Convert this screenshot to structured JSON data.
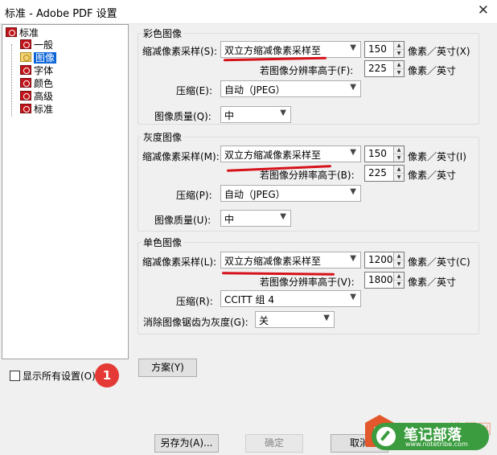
{
  "window": {
    "title": "标准 - Adobe PDF 设置",
    "close_glyph": "✕"
  },
  "tree": {
    "items": [
      {
        "label": "标准",
        "icon": "pdf-settings-icon",
        "selected": false
      },
      {
        "label": "一般",
        "icon": "pdf-settings-icon",
        "selected": false
      },
      {
        "label": "图像",
        "icon": "open-folder-icon",
        "selected": true
      },
      {
        "label": "字体",
        "icon": "pdf-settings-icon",
        "selected": false
      },
      {
        "label": "颜色",
        "icon": "pdf-settings-icon",
        "selected": false
      },
      {
        "label": "高级",
        "icon": "pdf-settings-icon",
        "selected": false
      },
      {
        "label": "标准",
        "icon": "pdf-settings-icon",
        "selected": false
      }
    ]
  },
  "show_all": {
    "label": "显示所有设置(O)",
    "checked": false,
    "badge": "1"
  },
  "color_images": {
    "title": "彩色图像",
    "downsample_label": "缩减像素采样(S):",
    "downsample_value": "双立方缩减像素采样至",
    "ppi_value": "150",
    "ppi_unit": "像素／英寸(X)",
    "above_label": "若图像分辨率高于(F):",
    "above_value": "225",
    "above_unit": "像素／英寸",
    "compression_label": "压缩(E):",
    "compression_value": "自动（JPEG）",
    "quality_label": "图像质量(Q):",
    "quality_value": "中"
  },
  "gray_images": {
    "title": "灰度图像",
    "downsample_label": "缩减像素采样(M):",
    "downsample_value": "双立方缩减像素采样至",
    "ppi_value": "150",
    "ppi_unit": "像素／英寸(I)",
    "above_label": "若图像分辨率高于(B):",
    "above_value": "225",
    "above_unit": "像素／英寸",
    "compression_label": "压缩(P):",
    "compression_value": "自动（JPEG）",
    "quality_label": "图像质量(U):",
    "quality_value": "中"
  },
  "mono_images": {
    "title": "单色图像",
    "downsample_label": "缩减像素采样(L):",
    "downsample_value": "双立方缩减像素采样至",
    "ppi_value": "1200",
    "ppi_unit": "像素／英寸(C)",
    "above_label": "若图像分辨率高于(V):",
    "above_value": "1800",
    "above_unit": "像素／英寸",
    "compression_label": "压缩(R):",
    "compression_value": "CCITT 组 4",
    "antialias_label": "消除图像锯齿为灰度(G):",
    "antialias_value": "关"
  },
  "buttons": {
    "policy": "方案(Y)",
    "save_as": "另存为(A)...",
    "ok": "确定",
    "cancel": "取消"
  },
  "watermark": {
    "brand_text": "Office教程网",
    "main_text": "笔记部落",
    "url_text": "www.notetribe.com"
  },
  "colors": {
    "annotation_red": "#d6111a",
    "selection_blue": "#0a64d8",
    "watermark_green": "#3a9c3e",
    "watermark_orange": "#e2572b"
  }
}
